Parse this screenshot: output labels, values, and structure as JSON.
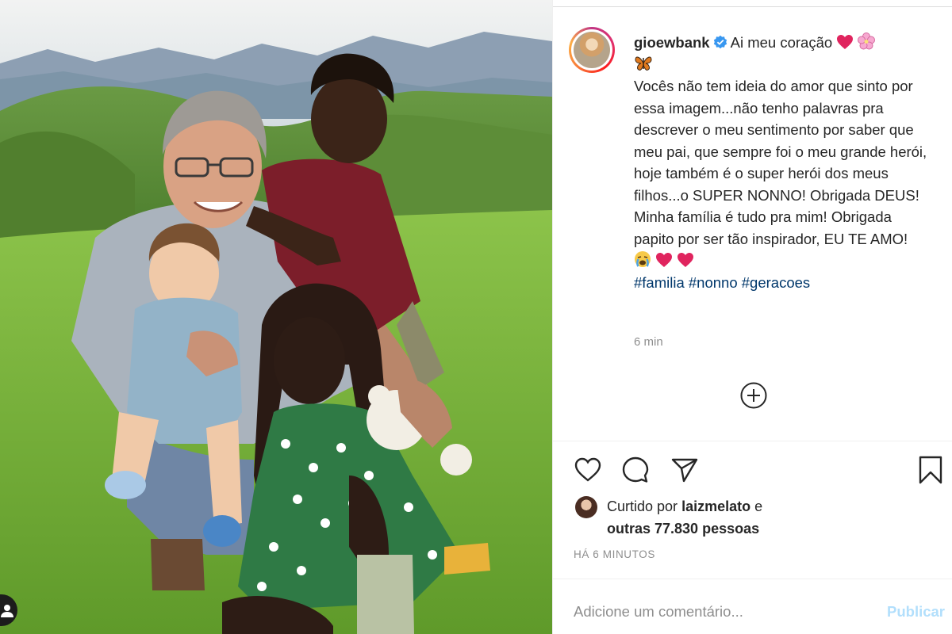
{
  "post": {
    "username": "gioewbank",
    "caption_head": "Ai meu coração",
    "caption_body": "Vocês não tem ideia do amor que sinto por essa imagem...não tenho palavras pra descrever o meu sentimento por saber que meu pai, que sempre foi o meu grande herói, hoje também é o super herói dos meus filhos...o SUPER NONNO! Obrigada DEUS! Minha família é tudo pra mim! Obrigada papito por ser tão inspirador, EU TE AMO!",
    "hashtags": [
      "#familia",
      "#nonno",
      "#geracoes"
    ],
    "caption_time": "6 min"
  },
  "likes": {
    "prefix": "Curtido por",
    "user": "laizmelato",
    "connector": "e",
    "others": "outras 77.830 pessoas"
  },
  "timestamp": "HÁ 6 MINUTOS",
  "comment": {
    "placeholder": "Adicione um comentário...",
    "publish_label": "Publicar"
  },
  "icons": {
    "verified": "verified-badge-icon",
    "load_more": "plus-circle-icon",
    "like": "heart-outline-icon",
    "comment": "comment-bubble-icon",
    "share": "paper-plane-icon",
    "save": "bookmark-icon",
    "tag": "user-tag-icon"
  },
  "colors": {
    "text": "#262626",
    "muted": "#8e8e8e",
    "hashtag": "#00376b",
    "verified": "#3897f0",
    "publish_disabled": "#b2dffc",
    "heart": "#e0245e"
  }
}
